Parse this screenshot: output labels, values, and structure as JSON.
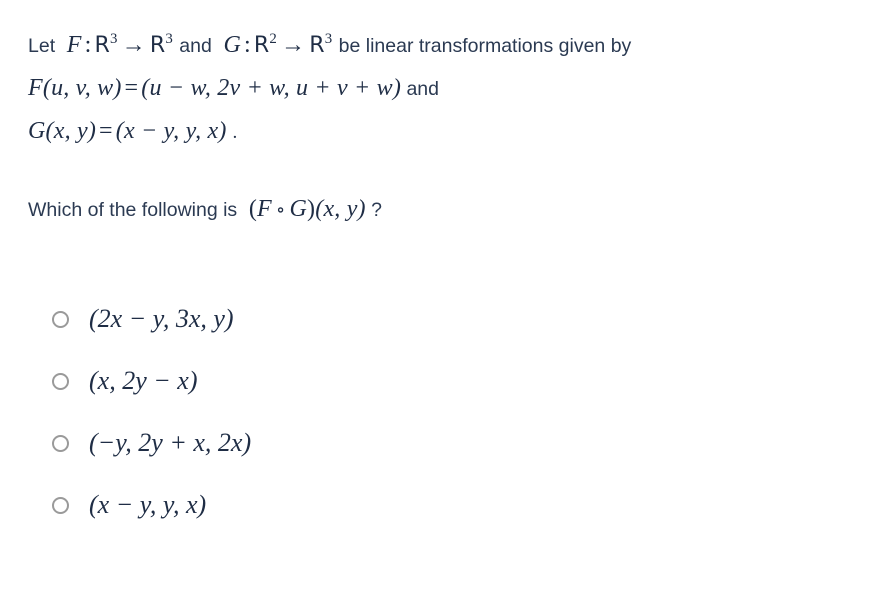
{
  "document": {
    "type": "multiple-choice-math-question",
    "background_color": "#ffffff",
    "text_color": "#2b3a52",
    "math_color": "#1f2d45",
    "radio_border_color": "#9a9a9a"
  },
  "stem": {
    "line1": {
      "lead": "Let",
      "f_name": "F",
      "colon": ":",
      "f_domain_set": "R",
      "f_domain_exp": "3",
      "arrow": "→",
      "f_codomain_set": "R",
      "f_codomain_exp": "3",
      "conjunction": "and",
      "g_name": "G",
      "g_domain_set": "R",
      "g_domain_exp": "2",
      "g_codomain_set": "R",
      "g_codomain_exp": "3",
      "tail": "be linear transformations given by"
    },
    "line2": {
      "fn": "F",
      "args": "(u, v, w)",
      "equals": "=",
      "value": "(u − w, 2v + w, u + v + w)",
      "trailing_word": "and",
      "parts": {
        "open": "(",
        "u": "u",
        "minus": "−",
        "w": "w",
        "comma1": ",",
        "two": "2",
        "v": "v",
        "plus1": "+",
        "w2": "w",
        "comma2": ",",
        "u2": "u",
        "plus2": "+",
        "v2": "v",
        "plus3": "+",
        "w3": "w",
        "close": ")"
      }
    },
    "line3": {
      "fn": "G",
      "args": "(x, y)",
      "equals": "=",
      "value": "(x − y, y, x)",
      "period": "."
    }
  },
  "question": {
    "prefix": "Which of the following is",
    "composition": "(F ∘ G)(x, y)",
    "f": "F",
    "ring": "∘",
    "g": "G",
    "vars": "(x, y)",
    "suffix": "?"
  },
  "options": [
    {
      "id": "option-a",
      "selected": false,
      "text": "(2x − y, 3x, y)",
      "tokens": [
        "(",
        "2",
        "x",
        "−",
        "y",
        ",",
        "3",
        "x",
        ",",
        "y",
        ")"
      ]
    },
    {
      "id": "option-b",
      "selected": false,
      "text": "(x, 2y − x)",
      "tokens": [
        "(",
        "x",
        ",",
        "2",
        "y",
        "−",
        "x",
        ")"
      ]
    },
    {
      "id": "option-c",
      "selected": false,
      "text": "(−y, 2y + x, 2x)",
      "tokens": [
        "(",
        "−",
        "y",
        ",",
        "2",
        "y",
        "+",
        "x",
        ",",
        "2",
        "x",
        ")"
      ]
    },
    {
      "id": "option-d",
      "selected": false,
      "text": "(x − y, y, x)",
      "tokens": [
        "(",
        "x",
        "−",
        "y",
        ",",
        "y",
        ",",
        "x",
        ")"
      ]
    }
  ]
}
